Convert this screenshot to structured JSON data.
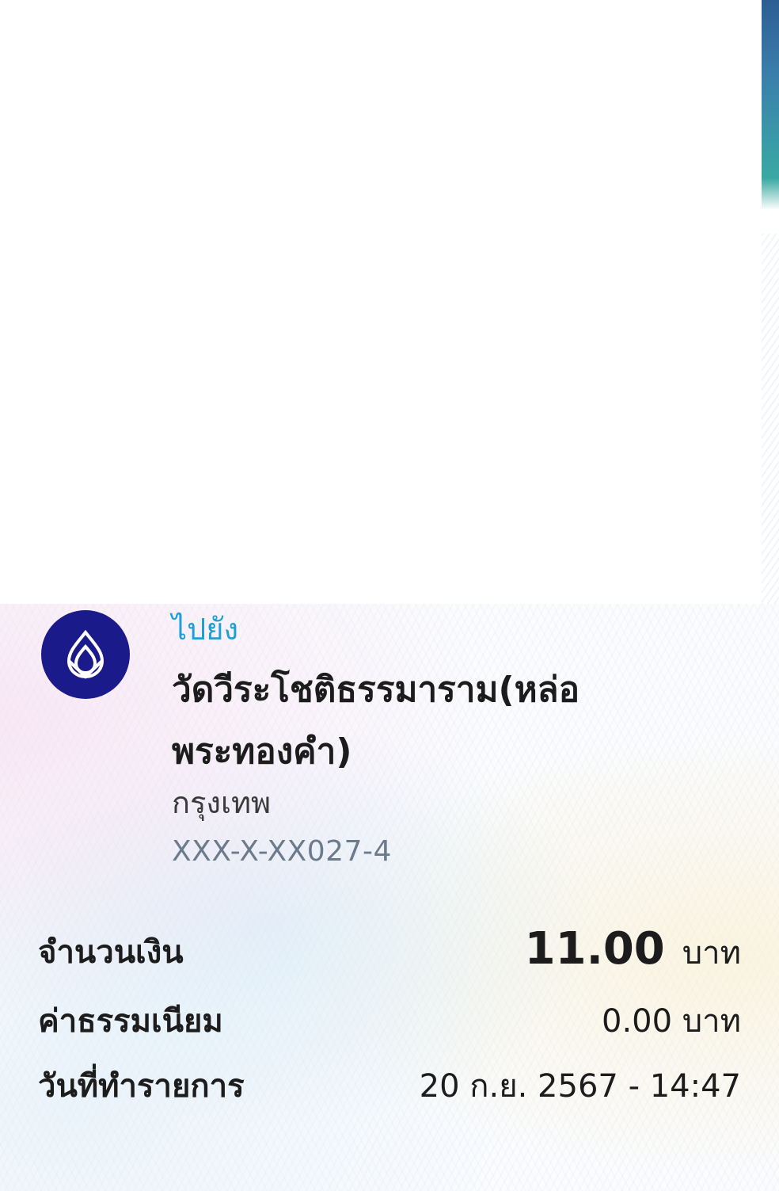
{
  "receipt": {
    "to_label": "ไปยัง",
    "recipient_name": "วัดวีระโชติธรรมาราม(หล่อพระทองคำ)",
    "bank_name": "กรุงเทพ",
    "account_number": "XXX-X-XX027-4",
    "bank_logo_icon": "bangkok-bank-lotus-icon",
    "bank_logo_color": "#1b1a8a",
    "accent_color": "#1e9fd8"
  },
  "details": {
    "amount_label": "จำนวนเงิน",
    "amount_value": "11.00",
    "amount_unit": "บาท",
    "fee_label": "ค่าธรรมเนียม",
    "fee_value": "0.00 บาท",
    "date_label": "วันที่ทำรายการ",
    "date_value": "20 ก.ย. 2567 - 14:47"
  }
}
